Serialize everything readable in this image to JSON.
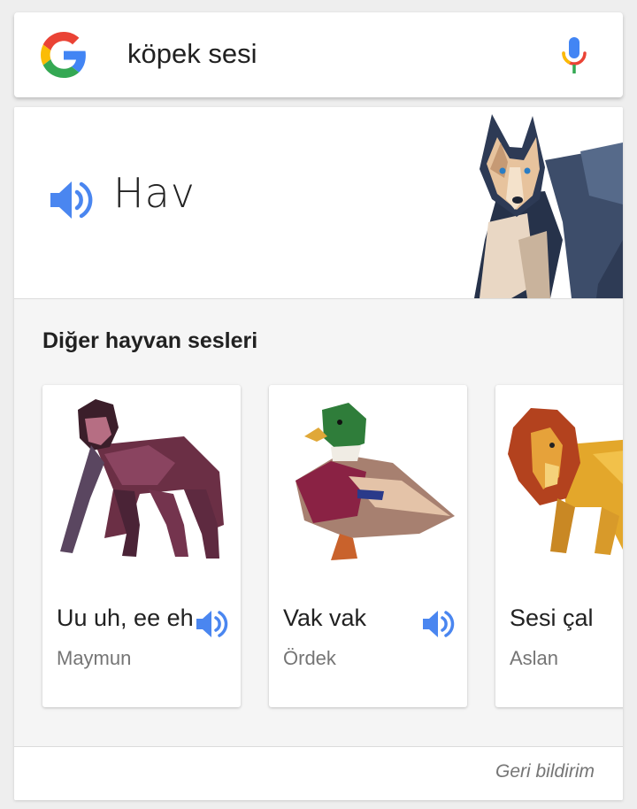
{
  "search": {
    "query": "köpek sesi"
  },
  "result": {
    "sound": "Hav",
    "animal_icon": "dog-illustration"
  },
  "other_sounds": {
    "title": "Diğer hayvan sesleri",
    "items": [
      {
        "sound": "Uu uh, ee eh",
        "name": "Maymun",
        "image": "gorilla-illustration"
      },
      {
        "sound": "Vak vak",
        "name": "Ördek",
        "image": "duck-illustration"
      },
      {
        "sound": "Sesi çal",
        "name": "Aslan",
        "image": "lion-illustration"
      }
    ]
  },
  "footer": {
    "feedback": "Geri bildirim"
  },
  "colors": {
    "speaker_blue": "#4a86f0",
    "google_blue": "#4285f4",
    "google_red": "#ea4335",
    "google_yellow": "#fbbc05",
    "google_green": "#34a853"
  }
}
